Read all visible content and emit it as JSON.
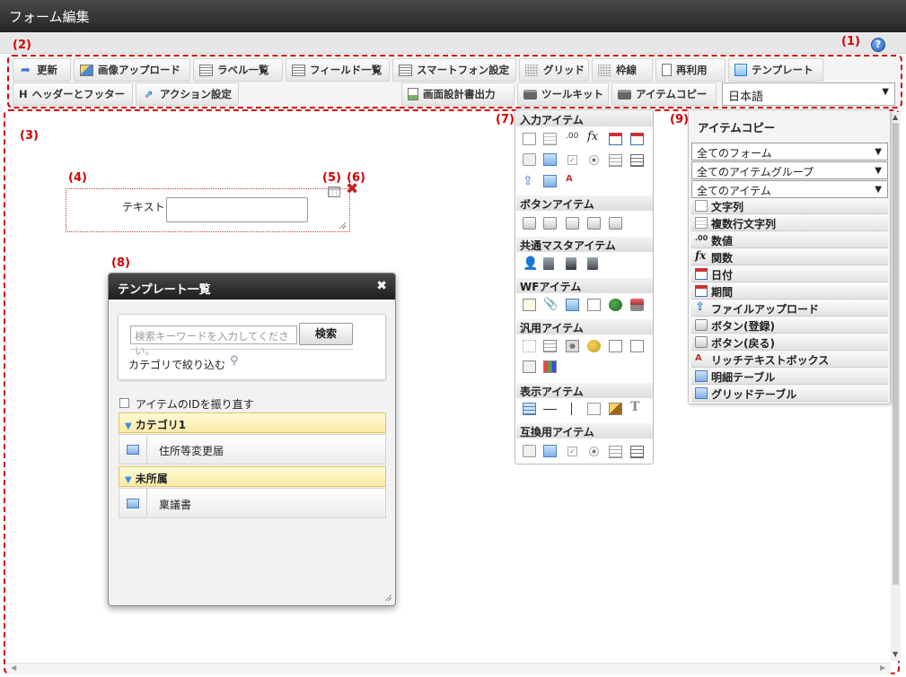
{
  "window": {
    "title": "フォーム編集"
  },
  "annotations": {
    "n1": "(1)",
    "n2": "(2)",
    "n3": "(3)",
    "n4": "(4)",
    "n5": "(5)",
    "n6": "(6)",
    "n7": "(7)",
    "n8": "(8)",
    "n9": "(9)"
  },
  "toolbar": {
    "row1": [
      "更新",
      "画像アップロード",
      "ラベル一覧",
      "フィールド一覧",
      "スマートフォン設定",
      "グリッド",
      "枠線",
      "再利用",
      "テンプレート"
    ],
    "row2": [
      "ヘッダーとフッター",
      "アクション設定",
      "画面設計書出力",
      "ツールキット",
      "アイテムコピー"
    ],
    "language": "日本語"
  },
  "form": {
    "text_label": "テキスト"
  },
  "template_dialog": {
    "title": "テンプレート一覧",
    "close": "✖",
    "search_placeholder": "検索キーワードを入力してください。",
    "search_button": "検索",
    "category_filter": "カテゴリで絞り込む",
    "reassign_ids": "アイテムのIDを振り直す",
    "categories": [
      {
        "name": "カテゴリ1",
        "items": [
          "住所等変更届"
        ]
      },
      {
        "name": "未所属",
        "items": [
          "稟議書"
        ]
      }
    ]
  },
  "palette": {
    "sections": [
      "入力アイテム",
      "ボタンアイテム",
      "共通マスタアイテム",
      "WFアイテム",
      "汎用アイテム",
      "表示アイテム",
      "互換用アイテム"
    ]
  },
  "item_copy": {
    "title": "アイテムコピー",
    "selects": [
      "全てのフォーム",
      "全てのアイテムグループ",
      "全てのアイテム"
    ],
    "items": [
      "文字列",
      "複数行文字列",
      "数値",
      "関数",
      "日付",
      "期間",
      "ファイルアップロード",
      "ボタン(登録)",
      "ボタン(戻る)",
      "リッチテキストボックス",
      "明細テーブル",
      "グリッドテーブル"
    ]
  }
}
